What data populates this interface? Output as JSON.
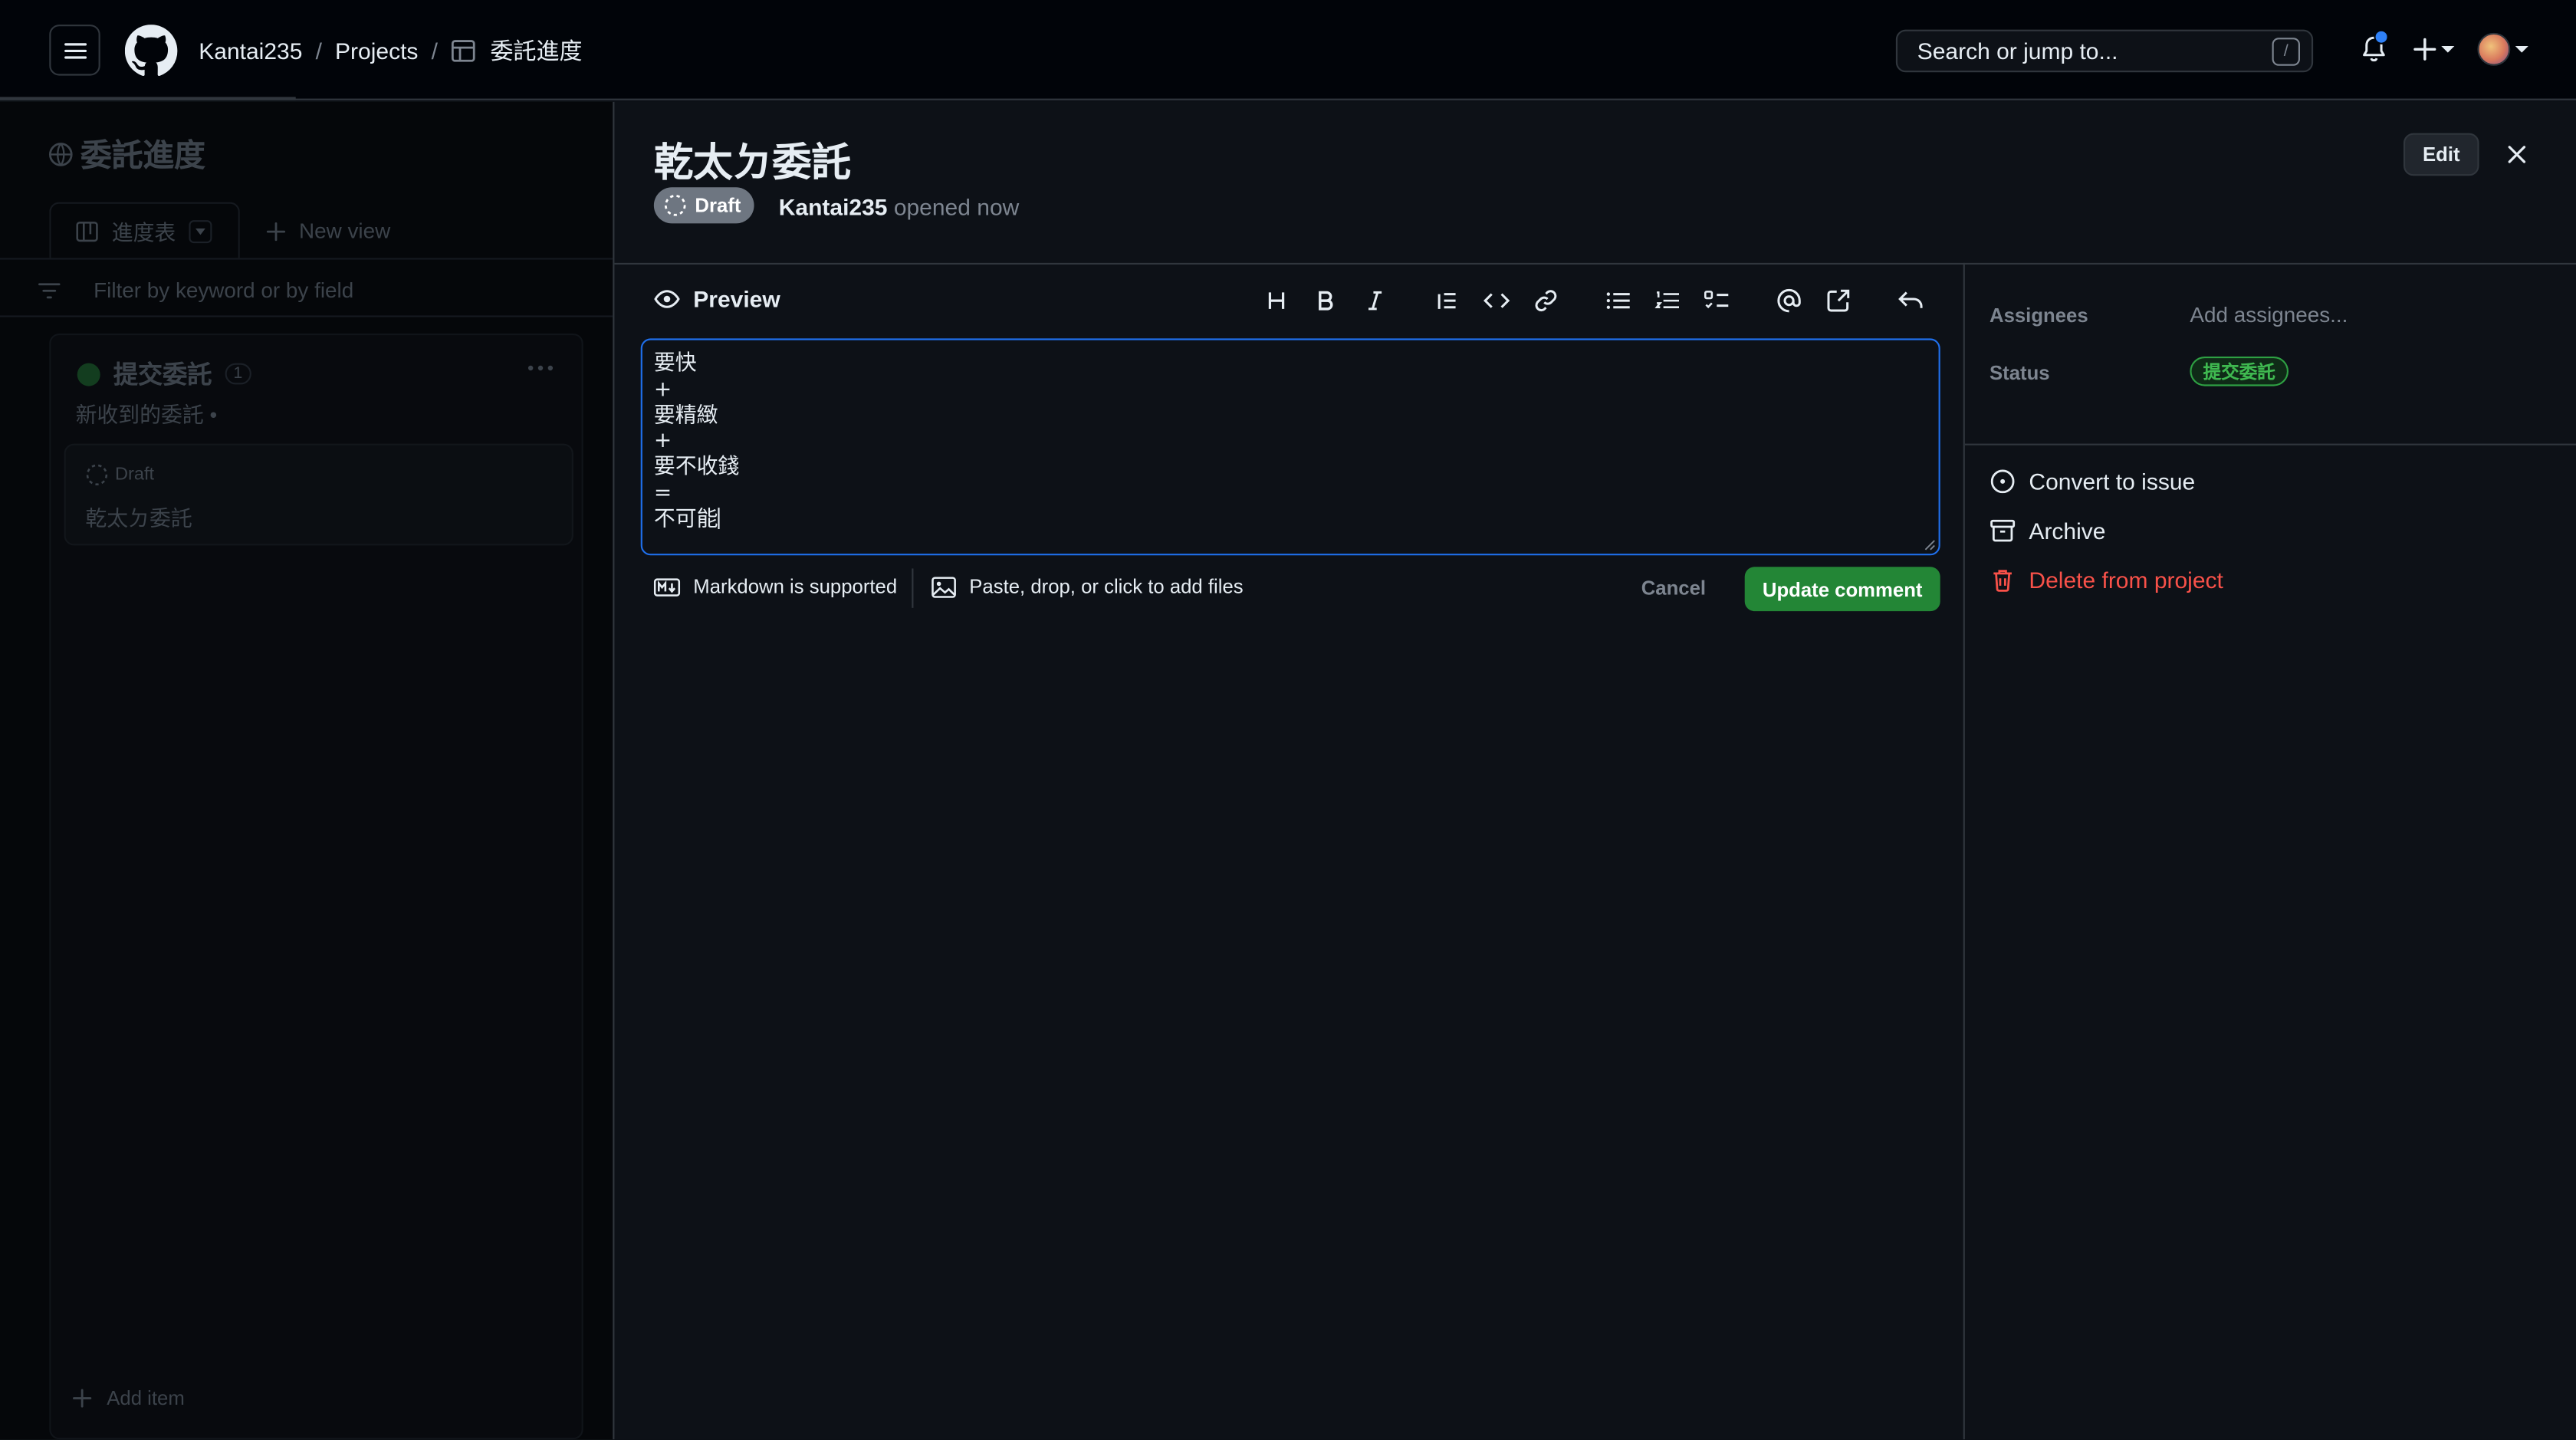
{
  "header": {
    "breadcrumbs": {
      "user": "Kantai235",
      "sep1": "/",
      "projects": "Projects",
      "sep2": "/",
      "project": "委託進度"
    },
    "search": {
      "placeholder": "Search or jump to...",
      "shortcut": "/"
    }
  },
  "board": {
    "title": "委託進度",
    "views": {
      "current": "進度表",
      "new_view": "New view"
    },
    "filter_placeholder": "Filter by keyword or by field",
    "column": {
      "name": "提交委託",
      "count": "1",
      "description": "新收到的委託 •"
    },
    "card": {
      "state": "Draft",
      "title": "乾太ㄉ委託"
    },
    "add_item": "Add item"
  },
  "item": {
    "title": "乾太ㄉ委託",
    "state_badge": "Draft",
    "author": "Kantai235",
    "opened_text": "opened now",
    "edit_label": "Edit"
  },
  "editor": {
    "tab_label": "Preview",
    "lines": [
      "要快",
      "+",
      "要精緻",
      "+",
      "要不收錢",
      "=",
      "不可能"
    ],
    "markdown_hint": "Markdown is supported",
    "files_hint": "Paste, drop, or click to add files",
    "cancel_label": "Cancel",
    "submit_label": "Update comment"
  },
  "sidebar": {
    "assignees_label": "Assignees",
    "assignees_value": "Add assignees...",
    "status_label": "Status",
    "status_value": "提交委託",
    "actions": {
      "convert": "Convert to issue",
      "archive": "Archive",
      "delete": "Delete from project"
    }
  },
  "colors": {
    "accent_blue": "#1f6feb",
    "success_green": "#238636",
    "danger_red": "#f85149",
    "notification_dot": "#2f81f7"
  }
}
